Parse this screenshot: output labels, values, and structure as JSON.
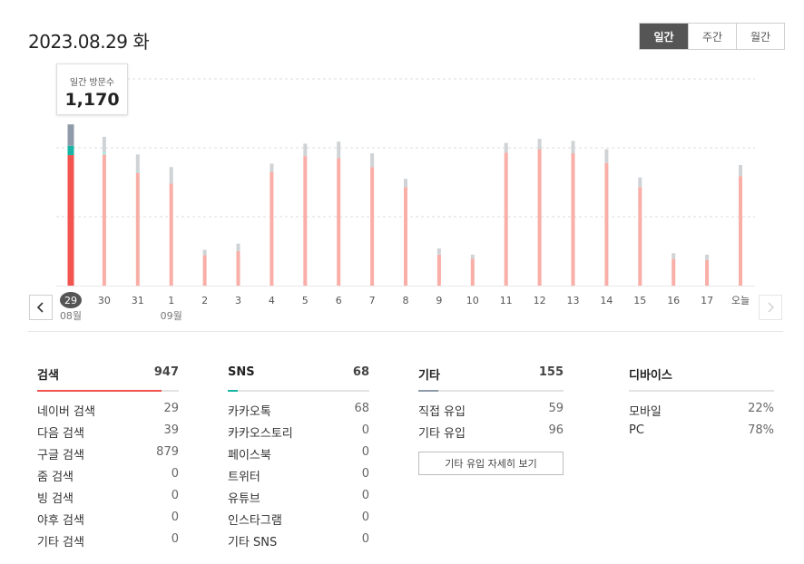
{
  "header": {
    "date": "2023.08.29 화"
  },
  "period_tabs": [
    {
      "label": "일간",
      "active": true
    },
    {
      "label": "주간",
      "active": false
    },
    {
      "label": "월간",
      "active": false
    }
  ],
  "tooltip": {
    "label": "일간 방문수",
    "value": "1,170"
  },
  "chart_data": {
    "type": "bar",
    "categories": [
      "29",
      "30",
      "31",
      "1",
      "2",
      "3",
      "4",
      "5",
      "6",
      "7",
      "8",
      "9",
      "10",
      "11",
      "12",
      "13",
      "14",
      "15",
      "16",
      "17",
      "오늘"
    ],
    "month_labels": [
      {
        "at": "29",
        "text": "08월"
      },
      {
        "at": "1",
        "text": "09월"
      }
    ],
    "selected_index": 0,
    "ylim": [
      0,
      1500
    ],
    "grid": true,
    "series": [
      {
        "name": "검색",
        "values": [
          947,
          950,
          820,
          740,
          220,
          250,
          825,
          940,
          925,
          860,
          715,
          225,
          195,
          965,
          990,
          960,
          890,
          715,
          195,
          185,
          795
        ]
      },
      {
        "name": "SNS",
        "values": [
          68,
          20,
          12,
          0,
          0,
          0,
          0,
          0,
          0,
          0,
          0,
          0,
          0,
          0,
          0,
          0,
          0,
          0,
          0,
          0,
          0
        ]
      },
      {
        "name": "기타",
        "values": [
          155,
          110,
          120,
          120,
          40,
          55,
          60,
          90,
          120,
          100,
          60,
          45,
          30,
          70,
          75,
          90,
          100,
          70,
          40,
          40,
          80
        ]
      }
    ],
    "colors": {
      "search_selected": "#f2544f",
      "search": "#f9aea7",
      "sns_selected": "#18b4a4",
      "sns": "#b3e6df",
      "etc_selected": "#8f9ba8",
      "etc": "#cfd3d6"
    }
  },
  "nav": {
    "prev_icon": "chevron-left-icon",
    "next_icon": "chevron-right-icon"
  },
  "stats": {
    "search": {
      "title": "검색",
      "total": "947",
      "color": "#f2544f",
      "fill_ratio": 0.88,
      "rows": [
        {
          "label": "네이버 검색",
          "value": "29"
        },
        {
          "label": "다음 검색",
          "value": "39"
        },
        {
          "label": "구글 검색",
          "value": "879"
        },
        {
          "label": "줌 검색",
          "value": "0"
        },
        {
          "label": "빙 검색",
          "value": "0"
        },
        {
          "label": "야후 검색",
          "value": "0"
        },
        {
          "label": "기타 검색",
          "value": "0"
        }
      ]
    },
    "sns": {
      "title": "SNS",
      "total": "68",
      "color": "#18b4a4",
      "fill_ratio": 0.07,
      "rows": [
        {
          "label": "카카오톡",
          "value": "68"
        },
        {
          "label": "카카오스토리",
          "value": "0"
        },
        {
          "label": "페이스북",
          "value": "0"
        },
        {
          "label": "트위터",
          "value": "0"
        },
        {
          "label": "유튜브",
          "value": "0"
        },
        {
          "label": "인스타그램",
          "value": "0"
        },
        {
          "label": "기타 SNS",
          "value": "0"
        }
      ]
    },
    "etc": {
      "title": "기타",
      "total": "155",
      "color": "#8f9ba8",
      "fill_ratio": 0.14,
      "rows": [
        {
          "label": "직접 유입",
          "value": "59"
        },
        {
          "label": "기타 유입",
          "value": "96"
        }
      ],
      "detail_button": "기타 유입 자세히 보기"
    },
    "device": {
      "title": "디바이스",
      "rows": [
        {
          "label": "모바일",
          "value": "22%"
        },
        {
          "label": "PC",
          "value": "78%"
        }
      ]
    }
  }
}
